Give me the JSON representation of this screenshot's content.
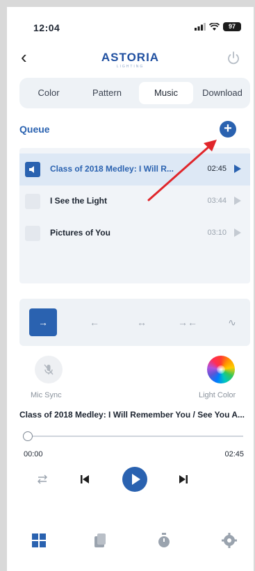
{
  "status_bar": {
    "time": "12:04",
    "battery": "97"
  },
  "header": {
    "brand": "ASTORIA",
    "brand_sub": "LIGHTING"
  },
  "tabs": [
    {
      "label": "Color",
      "active": false
    },
    {
      "label": "Pattern",
      "active": false
    },
    {
      "label": "Music",
      "active": true
    },
    {
      "label": "Download",
      "active": false
    }
  ],
  "queue": {
    "title": "Queue",
    "items": [
      {
        "title": "Class of 2018 Medley: I Will R...",
        "duration": "02:45",
        "active": true
      },
      {
        "title": "I See the Light",
        "duration": "03:44",
        "active": false
      },
      {
        "title": "Pictures of You",
        "duration": "03:10",
        "active": false
      }
    ]
  },
  "modes": [
    "→",
    "←",
    "↔",
    "→←",
    "∿"
  ],
  "mic_sync": {
    "label": "Mic Sync"
  },
  "light_color": {
    "label": "Light Color"
  },
  "now_playing": {
    "title": "Class of 2018 Medley: I Will Remember You / See You A...",
    "current_time": "00:00",
    "total_time": "02:45",
    "progress": 0.0
  },
  "colors": {
    "accent": "#2a62b0",
    "annotation_arrow": "#e0262b"
  },
  "bottom_nav": [
    "dashboard-icon",
    "scenes-icon",
    "timer-icon",
    "settings-icon"
  ]
}
